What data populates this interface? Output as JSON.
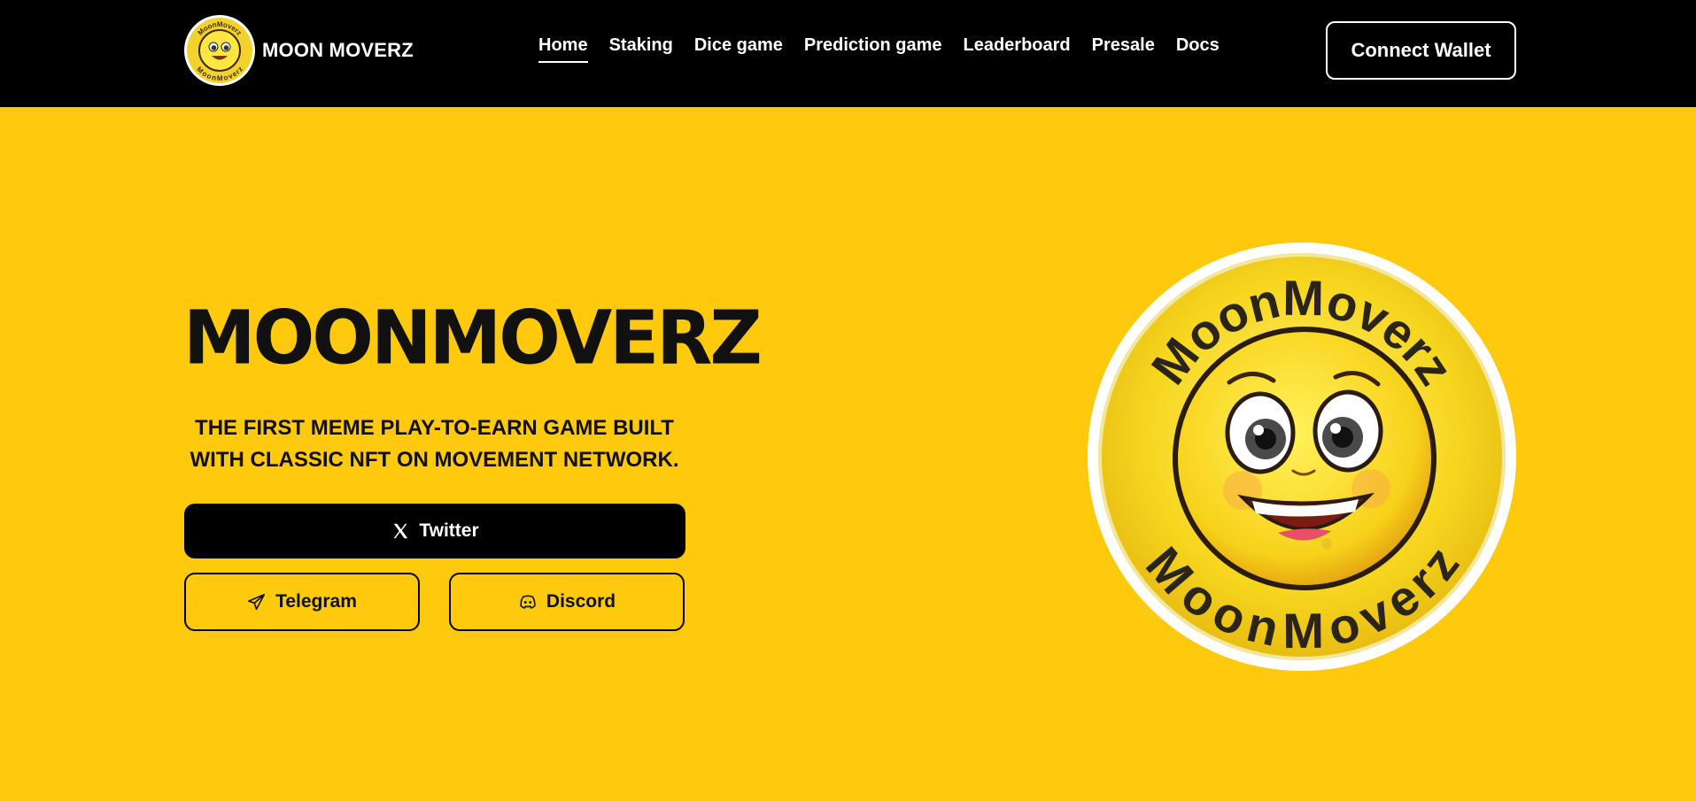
{
  "brand": {
    "name": "MOON MOVERZ",
    "logo_icon": "moon-face-logo-icon"
  },
  "nav": {
    "items": [
      {
        "label": "Home",
        "active": true
      },
      {
        "label": "Staking",
        "active": false
      },
      {
        "label": "Dice game",
        "active": false
      },
      {
        "label": "Prediction game",
        "active": false
      },
      {
        "label": "Leaderboard",
        "active": false
      },
      {
        "label": "Presale",
        "active": false
      },
      {
        "label": "Docs",
        "active": false
      }
    ]
  },
  "header": {
    "connect_label": "Connect Wallet"
  },
  "hero": {
    "title": "MOONMOVERZ",
    "tagline": "THE FIRST MEME PLAY-TO-EARN GAME BUILT WITH CLASSIC NFT ON MOVEMENT NETWORK.",
    "badge_text_top": "MoonMoverz",
    "badge_text_bottom": "MoonMoverz"
  },
  "social": {
    "twitter_label": "Twitter",
    "telegram_label": "Telegram",
    "discord_label": "Discord"
  },
  "colors": {
    "background": "#FFC90E",
    "header": "#000000",
    "text": "#111111",
    "accent": "#FFFFFF"
  }
}
